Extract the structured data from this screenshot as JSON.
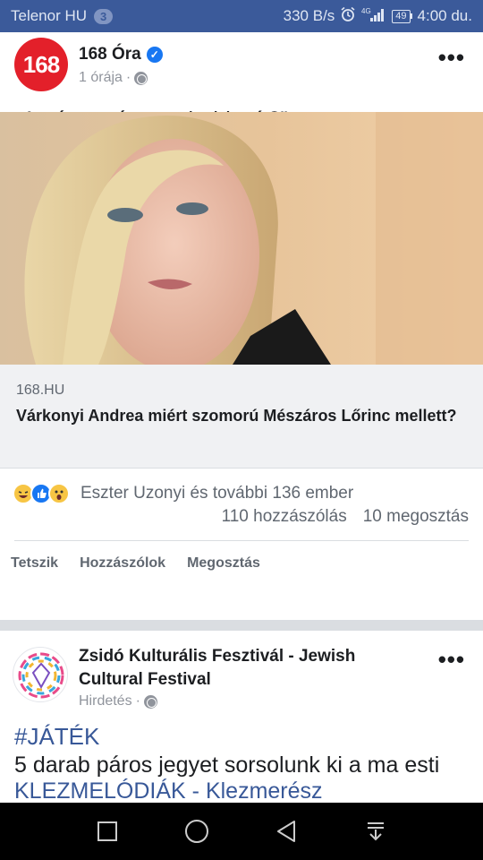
{
  "status_bar": {
    "carrier": "Telenor HU",
    "carrier_badge": "3",
    "speed": "330 B/s",
    "network": "4G",
    "battery": "49",
    "time": "4:00 du."
  },
  "post1": {
    "avatar_text": "168",
    "page_name": "168 Óra",
    "time": "1 órája",
    "text": "„A pénz mégsem boldogít?”",
    "link": {
      "domain": "168.HU",
      "title": "Várkonyi Andrea miért szomorú Mészáros Lőrinc mellett?"
    },
    "reactions": {
      "reactors": "Eszter Uzonyi és további 136 ember",
      "comments": "110 hozzászólás",
      "shares": "10 megosztás"
    },
    "actions": {
      "like": "Tetszik",
      "comment": "Hozzászólok",
      "share": "Megosztás"
    }
  },
  "post2": {
    "page_name": "Zsidó Kulturális Fesztivál - Jewish Cultural Festival",
    "meta": "Hirdetés",
    "hashtag": "#JÁTÉK",
    "text_before": "5 darab páros jegyet sorsolunk ki a ma esti ",
    "text_link": "KLEZMELÓDIÁK - Klezmerész"
  },
  "colors": {
    "status_bar": "#3b5a9a",
    "accent_red": "#e3202a",
    "link_blue": "#385898",
    "verified_blue": "#1877f2"
  }
}
